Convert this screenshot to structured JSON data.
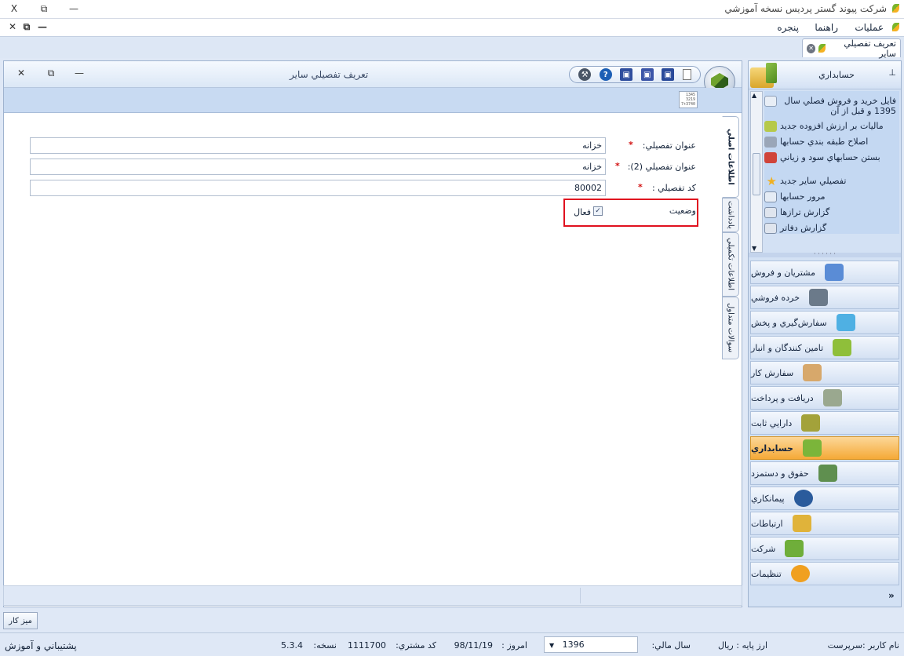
{
  "app": {
    "title": "شركت پيوند گستر پرديس نسخه آموزشي",
    "window_controls": [
      "X",
      "⧉",
      "—"
    ]
  },
  "menu": {
    "items": [
      "عمليات",
      "راهنما",
      "پنجره"
    ],
    "mdi_controls": [
      "✕",
      "⧉",
      "—"
    ]
  },
  "doc_tab": {
    "label": "تعريف تفصيلي ساير"
  },
  "inner_window": {
    "title": "تعريف تفصيلي ساير",
    "calc_text": "1345\n3219\n7+3740"
  },
  "toolbar": {
    "help": "?"
  },
  "form": {
    "title_label": "عنوان تفصيلي:",
    "title_value": "خزانه",
    "title2_label": "عنوان تفصيلي (2):",
    "title2_value": "خزانه",
    "code_label": "كد تفصيلي :",
    "code_value": "80002",
    "status_label": "وضعيت",
    "active_label": "فعال",
    "required_mark": "*",
    "active_checked": true
  },
  "vtabs": [
    "اطلاعات اصلي",
    "يادداشت",
    "اطلاعات تكميلي",
    "سوالات متداول"
  ],
  "right_panel": {
    "header": "حسابداري",
    "pin": "⊥",
    "tasks": [
      {
        "label": "فايل خريد و فروش فصلي سال 1395 و قبل از آن",
        "icon": "file-report-icon"
      },
      {
        "label": "ماليات بر ارزش افزوده جديد",
        "icon": "tax-icon"
      },
      {
        "label": "اصلاح طبقه بندي حسابها",
        "icon": "edit-icon"
      },
      {
        "label": "بستن حسابهاي سود و زياني",
        "icon": "close-book-icon"
      },
      {
        "label": "تفصيلي ساير جديد",
        "icon": "star-icon"
      },
      {
        "label": "مرور حسابها",
        "icon": "browse-icon"
      },
      {
        "label": "گزارش ترازها",
        "icon": "report-icon"
      },
      {
        "label": "گزارش دفاتر",
        "icon": "ledger-icon"
      }
    ],
    "nav": [
      {
        "label": "مشتريان و فروش",
        "color": "#5a8cd6"
      },
      {
        "label": "خرده فروشي",
        "color": "#6b7a8a"
      },
      {
        "label": "سفارش‌گيري و پخش",
        "color": "#4fb0e3"
      },
      {
        "label": "تامين كنندگان و انبار",
        "color": "#8fbf3a"
      },
      {
        "label": "سفارش كار",
        "color": "#d7a86b"
      },
      {
        "label": "دريافت و پرداخت",
        "color": "#9aa88f"
      },
      {
        "label": "دارايي ثابت",
        "color": "#a3a23a"
      },
      {
        "label": "حسابداري",
        "color": "#7bb53a"
      },
      {
        "label": "حقوق و دستمزد",
        "color": "#5f8f4f"
      },
      {
        "label": "پيمانكاري",
        "color": "#2a5b9c"
      },
      {
        "label": "ارتباطات",
        "color": "#e0b33a"
      },
      {
        "label": "شركت",
        "color": "#6fae3a"
      },
      {
        "label": "تنظيمات",
        "color": "#f0a020"
      }
    ],
    "active_nav": "حسابداري",
    "expand": "»"
  },
  "desk_button": "ميز كار",
  "status": {
    "user": "نام كاربر :سرپرست",
    "base_currency": "ارز پايه : ريال",
    "fiscal_year_label": "سال مالي:",
    "fiscal_year": "1396",
    "today_label": "امروز :",
    "today": "98/11/19",
    "customer_code_label": "كد مشتري:",
    "customer_code": "1111700",
    "version_label": "نسخه:",
    "version": "5.3.4",
    "support": "پشتيباني و آموزش"
  }
}
